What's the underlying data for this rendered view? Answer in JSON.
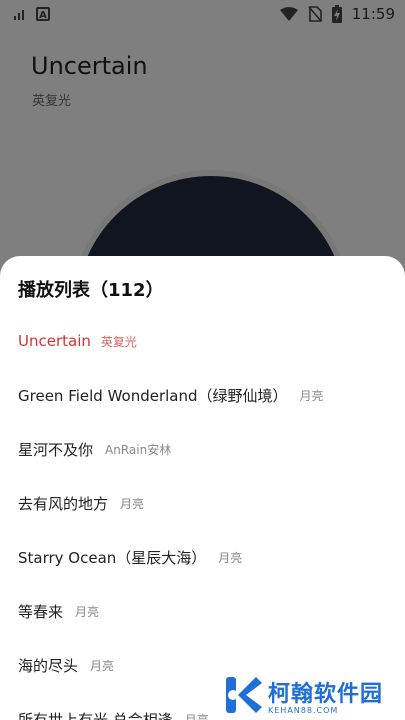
{
  "status_bar": {
    "time": "11:59"
  },
  "background_player": {
    "song_title": "Uncertain",
    "artist": "英复光"
  },
  "playlist_sheet": {
    "title": "播放列表（112）",
    "items": [
      {
        "name": "Uncertain",
        "artist": "英复光",
        "active": true
      },
      {
        "name": "Green Field Wonderland（绿野仙境）",
        "artist": "月亮"
      },
      {
        "name": "星河不及你",
        "artist": "AnRain安林"
      },
      {
        "name": "去有风的地方",
        "artist": "月亮"
      },
      {
        "name": "Starry Ocean（星辰大海）",
        "artist": "月亮"
      },
      {
        "name": "等春来",
        "artist": "月亮"
      },
      {
        "name": "海的尽头",
        "artist": "月亮"
      },
      {
        "name": "所有世上有光 总会相逢",
        "artist": "月亮"
      }
    ]
  },
  "watermark": {
    "name": "柯翰软件园",
    "domain": "KEHAN88.COM"
  },
  "colors": {
    "active_song": "#d0332e",
    "active_artist": "#d9665f",
    "watermark_blue": "#1f6fd6"
  }
}
